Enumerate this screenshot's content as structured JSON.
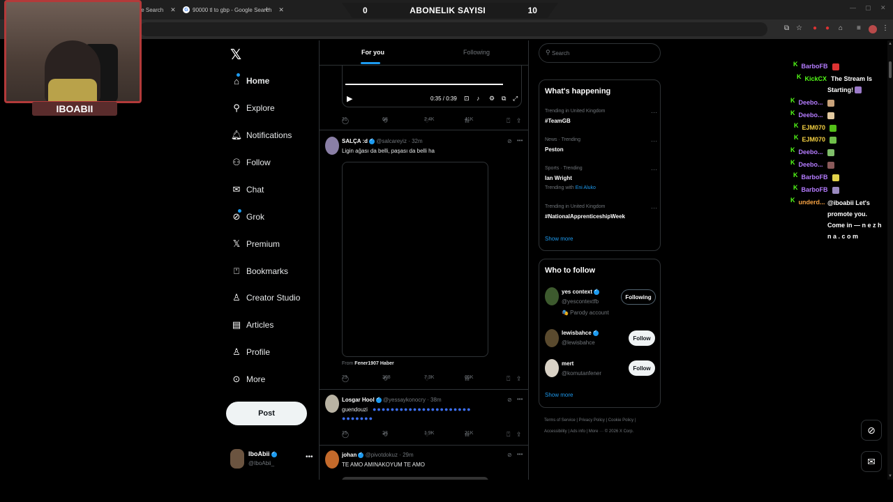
{
  "browser": {
    "tabs": [
      {
        "title": "gle Search"
      },
      {
        "title": "90000 tl to gbp - Google Search"
      }
    ],
    "new_tab_label": "+",
    "window_controls": [
      "—",
      "▢",
      "✕"
    ]
  },
  "stream": {
    "banner": {
      "left_count": "0",
      "title": "ABONELIK SAYISI",
      "right_count": "10"
    },
    "streamer_name": "IBOABII"
  },
  "nav": {
    "logo": "𝕏",
    "items": [
      {
        "label": "Home",
        "icon": "home-icon"
      },
      {
        "label": "Explore",
        "icon": "search-icon"
      },
      {
        "label": "Notifications",
        "icon": "bell-icon"
      },
      {
        "label": "Follow",
        "icon": "person-add-icon"
      },
      {
        "label": "Chat",
        "icon": "mail-icon"
      },
      {
        "label": "Grok",
        "icon": "grok-icon"
      },
      {
        "label": "Premium",
        "icon": "x-icon"
      },
      {
        "label": "Bookmarks",
        "icon": "bookmark-icon"
      },
      {
        "label": "Creator Studio",
        "icon": "creator-icon"
      },
      {
        "label": "Articles",
        "icon": "article-icon"
      },
      {
        "label": "Profile",
        "icon": "person-icon"
      },
      {
        "label": "More",
        "icon": "more-circle-icon"
      }
    ],
    "post_label": "Post",
    "account": {
      "name": "IboAbii",
      "handle": "@IboAbii_"
    }
  },
  "timeline": {
    "tabs": [
      {
        "label": "For you"
      },
      {
        "label": "Following"
      }
    ],
    "video": {
      "time": "0:35 / 0:39"
    },
    "first_actions": {
      "replies": "31",
      "reposts": "68",
      "likes": "2.4K",
      "views": "41K"
    },
    "tweets": [
      {
        "name": "SALÇA :d",
        "handle": "@salcareyiz",
        "time": "32m",
        "text": "Ligin ağası da belli, paşası da belli ha",
        "from_prefix": "From",
        "from_source": "Fener1907 Haber",
        "actions": {
          "replies": "23",
          "reposts": "308",
          "likes": "7.3K",
          "views": "65K"
        }
      },
      {
        "name": "Losgar Hool",
        "handle": "@yessaykonocry",
        "time": "38m",
        "text": "guendouzi",
        "emoji_line1": "●●●●●●●●●●●●●●●●●●●●●●",
        "emoji_line2": "●●●●●●●",
        "actions": {
          "replies": "15",
          "reposts": "23",
          "likes": "1.9K",
          "views": "21K"
        }
      },
      {
        "name": "johan",
        "handle": "@pivotdokuz",
        "time": "29m",
        "text": "TE AMO AMINAKOYUM TE AMO"
      }
    ]
  },
  "right": {
    "search_placeholder": "Search",
    "happening_title": "What's happening",
    "trends": [
      {
        "meta": "Trending in United Kingdom",
        "name": "#TeamGB",
        "sub": ""
      },
      {
        "meta": "News · Trending",
        "name": "Peston",
        "sub": ""
      },
      {
        "meta": "Sports · Trending",
        "name": "Ian Wright",
        "sub_prefix": "Trending with",
        "sub": "Eni Aluko"
      },
      {
        "meta": "Trending in United Kingdom",
        "name": "#NationalApprenticeshipWeek",
        "sub": ""
      }
    ],
    "show_more": "Show more",
    "wtf_title": "Who to follow",
    "wtf": [
      {
        "name": "yes context",
        "handle": "@yescontextfb",
        "extra": "🎭 Parody account",
        "button": "Following"
      },
      {
        "name": "lewisbahce",
        "handle": "@lewisbahce",
        "extra": "",
        "button": "Follow"
      },
      {
        "name": "mert",
        "handle": "@komutanfener",
        "extra": "",
        "button": "Follow"
      }
    ],
    "footer_line1": "Terms of Service  |  Privacy Policy  |  Cookie Policy  |",
    "footer_line2": "Accessibility  |  Ads info  |  More ···  © 2026 X Corp."
  },
  "chat": {
    "messages": [
      {
        "user": "BarboFB",
        "color": "#b57cff",
        "msg": ""
      },
      {
        "user": "KickCX",
        "color": "#53fc18",
        "msg": "The Stream Is"
      },
      {
        "user": "",
        "color": "#53fc18",
        "msg": "Starting!"
      },
      {
        "user": "Deebo...",
        "color": "#b57cff",
        "msg": ""
      },
      {
        "user": "Deebo...",
        "color": "#b57cff",
        "msg": ""
      },
      {
        "user": "EJM070",
        "color": "#f5d142",
        "msg": ""
      },
      {
        "user": "EJM070",
        "color": "#f5d142",
        "msg": ""
      },
      {
        "user": "Deebo...",
        "color": "#b57cff",
        "msg": ""
      },
      {
        "user": "Deebo...",
        "color": "#b57cff",
        "msg": ""
      },
      {
        "user": "BarboFB",
        "color": "#b57cff",
        "msg": ""
      },
      {
        "user": "BarboFB",
        "color": "#b57cff",
        "msg": ""
      },
      {
        "user": "underd...",
        "color": "#f5a142",
        "msg": ""
      }
    ],
    "long_message": "@iboabii Let's promote you. Come in — n e z h n a . c o m"
  },
  "colors": {
    "accent": "#1d9bf0",
    "kick_green": "#53fc18",
    "webcam_border": "#b33a3a"
  }
}
